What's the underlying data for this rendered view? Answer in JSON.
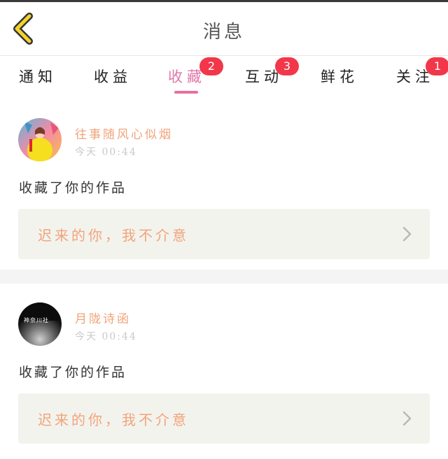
{
  "header": {
    "title": "消息",
    "back_icon": "chevron-left-icon"
  },
  "tabs": [
    {
      "label": "通知",
      "badge": ""
    },
    {
      "label": "收益",
      "badge": ""
    },
    {
      "label": "收藏",
      "badge": "2",
      "active": true
    },
    {
      "label": "互动",
      "badge": "3"
    },
    {
      "label": "鲜花",
      "badge": ""
    },
    {
      "label": "关注",
      "badge": "1"
    }
  ],
  "messages": [
    {
      "username": "往事随风心似烟",
      "time": "今天 00:44",
      "action": "收藏了你的作品",
      "quote": "迟来的你，我不介意"
    },
    {
      "username": "月陇诗函",
      "time": "今天 00:44",
      "action": "收藏了你的作品",
      "quote": "迟来的你，我不介意",
      "avatar_text": "神奈川社"
    }
  ],
  "colors": {
    "accent_pink": "#ea6f9f",
    "badge_red": "#f2374b",
    "username_orange": "#f1a47a",
    "back_yellow": "#f5d22b"
  }
}
